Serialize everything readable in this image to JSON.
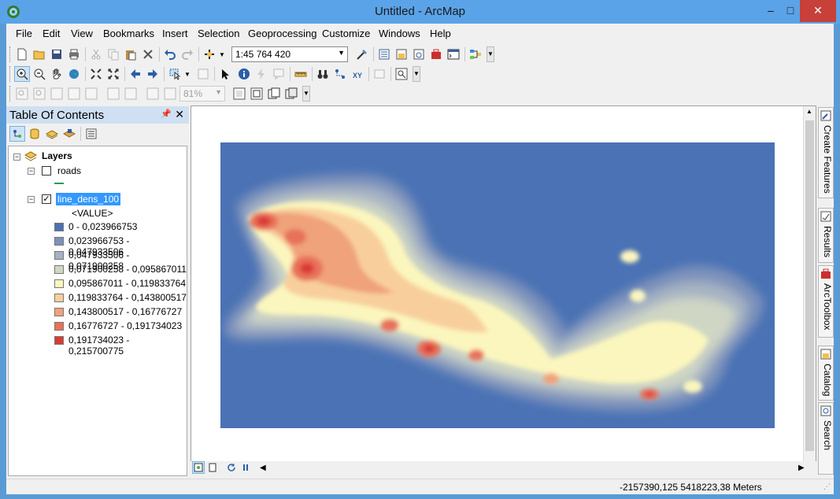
{
  "window": {
    "title": "Untitled - ArcMap",
    "minimize": "–",
    "maximize": "□",
    "close": "✕"
  },
  "menu": [
    "File",
    "Edit",
    "View",
    "Bookmarks",
    "Insert",
    "Selection",
    "Geoprocessing",
    "Customize",
    "Windows",
    "Help"
  ],
  "standard_toolbar": {
    "scale": "1:45 764 420"
  },
  "layout_toolbar": {
    "zoom": "81%"
  },
  "toc": {
    "title": "Table Of Contents",
    "root": "Layers",
    "layers": [
      {
        "name": "roads",
        "checked": false
      },
      {
        "name": "line_dens_100",
        "checked": true,
        "value_header": "<VALUE>"
      }
    ],
    "legend": [
      {
        "label": "0 - 0,023966753",
        "color": "#4a72b4"
      },
      {
        "label": "0,023966753 - 0,047933506",
        "color": "#7b91bb"
      },
      {
        "label": "0,047933506 - 0,071900258",
        "color": "#a5b2c3"
      },
      {
        "label": "0,071900258 - 0,095867011",
        "color": "#cfd6c4"
      },
      {
        "label": "0,095867011 - 0,119833764",
        "color": "#fbf6be"
      },
      {
        "label": "0,119833764 - 0,143800517",
        "color": "#f8cf9c"
      },
      {
        "label": "0,143800517 - 0,16776727",
        "color": "#f0a27a"
      },
      {
        "label": "0,16776727 - 0,191734023",
        "color": "#e8715a"
      },
      {
        "label": "0,191734023 - 0,215700775",
        "color": "#d93b35"
      }
    ]
  },
  "dock_tabs": [
    "Create Features",
    "Results",
    "ArcToolbox",
    "Catalog",
    "Search"
  ],
  "status": {
    "coordinates": "-2157390,125  5418223,38 Meters"
  }
}
